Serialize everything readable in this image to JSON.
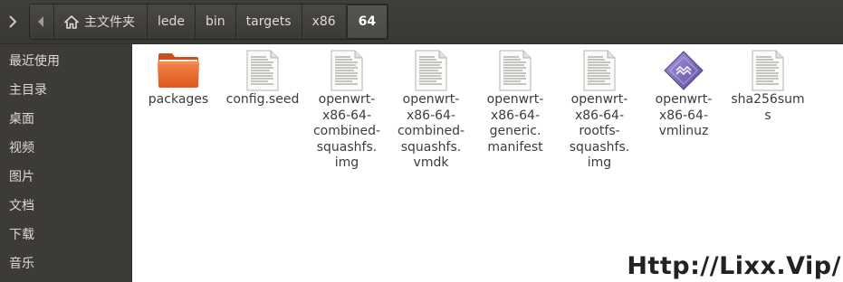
{
  "toolbar": {
    "breadcrumb": {
      "home_label": "主文件夹",
      "segments": [
        "lede",
        "bin",
        "targets",
        "x86"
      ],
      "current": "64"
    }
  },
  "sidebar": {
    "items": [
      "最近使用",
      "主目录",
      "桌面",
      "视频",
      "图片",
      "文档",
      "下载",
      "音乐"
    ]
  },
  "files": [
    {
      "name": "packages",
      "type": "folder"
    },
    {
      "name": "config.seed",
      "type": "text"
    },
    {
      "name": "openwrt-\nx86-64-\ncombined-\nsquashfs.\nimg",
      "type": "text"
    },
    {
      "name": "openwrt-\nx86-64-\ncombined-\nsquashfs.\nvmdk",
      "type": "text"
    },
    {
      "name": "openwrt-\nx86-64-\ngeneric.\nmanifest",
      "type": "text"
    },
    {
      "name": "openwrt-\nx86-64-\nrootfs-\nsquashfs.\nimg",
      "type": "text"
    },
    {
      "name": "openwrt-\nx86-64-\nvmlinuz",
      "type": "binary"
    },
    {
      "name": "sha256sum\ns",
      "type": "text"
    }
  ],
  "watermark": "Http://Lixx.Vip/",
  "colors": {
    "toolbar_bg": "#3c3b37",
    "sidebar_bg": "#3c3b37",
    "folder_orange": "#e9692c",
    "binary_purple": "#7b68b8"
  }
}
